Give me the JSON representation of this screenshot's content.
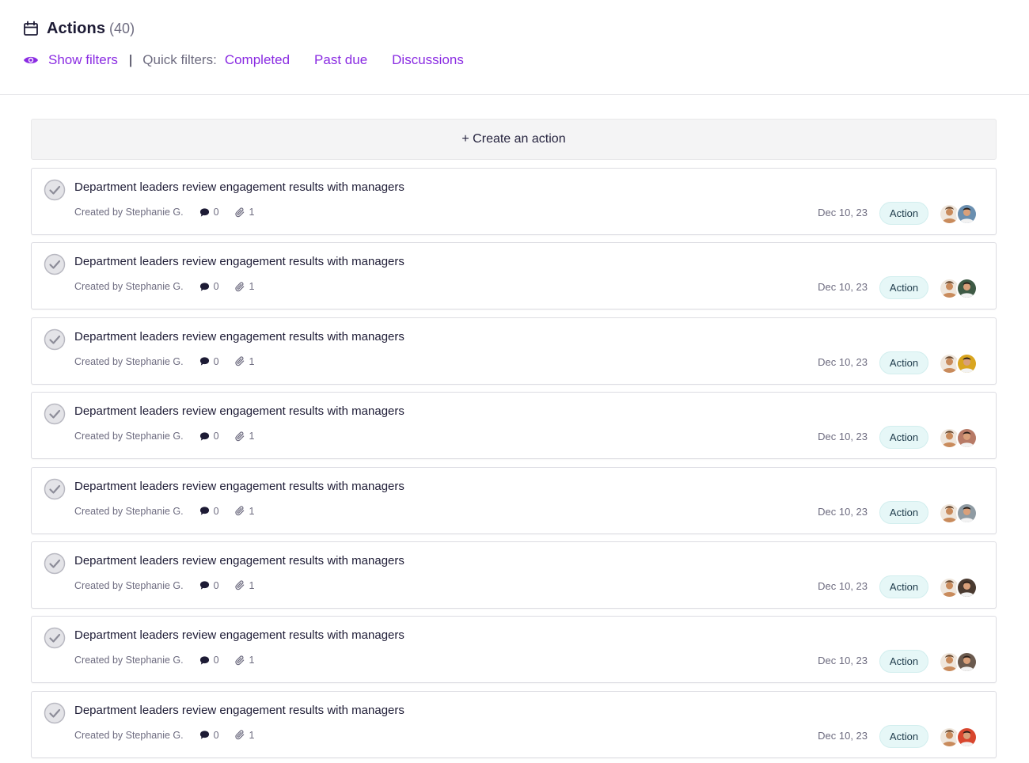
{
  "header": {
    "title": "Actions",
    "count": "(40)",
    "show_filters": "Show filters",
    "separator": "|",
    "quick_filters_label": "Quick filters:",
    "quick_filters": [
      "Completed",
      "Past due",
      "Discussions"
    ]
  },
  "create_button": "+ Create an action",
  "colors": {
    "accent": "#8a2be2",
    "badge_bg": "#e6f7f7",
    "text": "#1d1b35",
    "muted": "#6e6c80"
  },
  "actions": [
    {
      "title": "Department leaders review engagement results with managers",
      "created_by": "Created by Stephanie G.",
      "comments": "0",
      "attachments": "1",
      "date": "Dec 10, 23",
      "badge": "Action",
      "avatar_colors": [
        "#c98b5c",
        "#6a8fb0"
      ]
    },
    {
      "title": "Department leaders review engagement results with managers",
      "created_by": "Created by Stephanie G.",
      "comments": "0",
      "attachments": "1",
      "date": "Dec 10, 23",
      "badge": "Action",
      "avatar_colors": [
        "#c98b5c",
        "#3e5a45"
      ]
    },
    {
      "title": "Department leaders review engagement results with managers",
      "created_by": "Created by Stephanie G.",
      "comments": "0",
      "attachments": "1",
      "date": "Dec 10, 23",
      "badge": "Action",
      "avatar_colors": [
        "#c98b5c",
        "#d9a520"
      ]
    },
    {
      "title": "Department leaders review engagement results with managers",
      "created_by": "Created by Stephanie G.",
      "comments": "0",
      "attachments": "1",
      "date": "Dec 10, 23",
      "badge": "Action",
      "avatar_colors": [
        "#c98b5c",
        "#b77a66"
      ]
    },
    {
      "title": "Department leaders review engagement results with managers",
      "created_by": "Created by Stephanie G.",
      "comments": "0",
      "attachments": "1",
      "date": "Dec 10, 23",
      "badge": "Action",
      "avatar_colors": [
        "#c98b5c",
        "#8f9ba3"
      ]
    },
    {
      "title": "Department leaders review engagement results with managers",
      "created_by": "Created by Stephanie G.",
      "comments": "0",
      "attachments": "1",
      "date": "Dec 10, 23",
      "badge": "Action",
      "avatar_colors": [
        "#c98b5c",
        "#4a3a30"
      ]
    },
    {
      "title": "Department leaders review engagement results with managers",
      "created_by": "Created by Stephanie G.",
      "comments": "0",
      "attachments": "1",
      "date": "Dec 10, 23",
      "badge": "Action",
      "avatar_colors": [
        "#c98b5c",
        "#6b5a4e"
      ]
    },
    {
      "title": "Department leaders review engagement results with managers",
      "created_by": "Created by Stephanie G.",
      "comments": "0",
      "attachments": "1",
      "date": "Dec 10, 23",
      "badge": "Action",
      "avatar_colors": [
        "#c98b5c",
        "#d8462e"
      ]
    }
  ]
}
